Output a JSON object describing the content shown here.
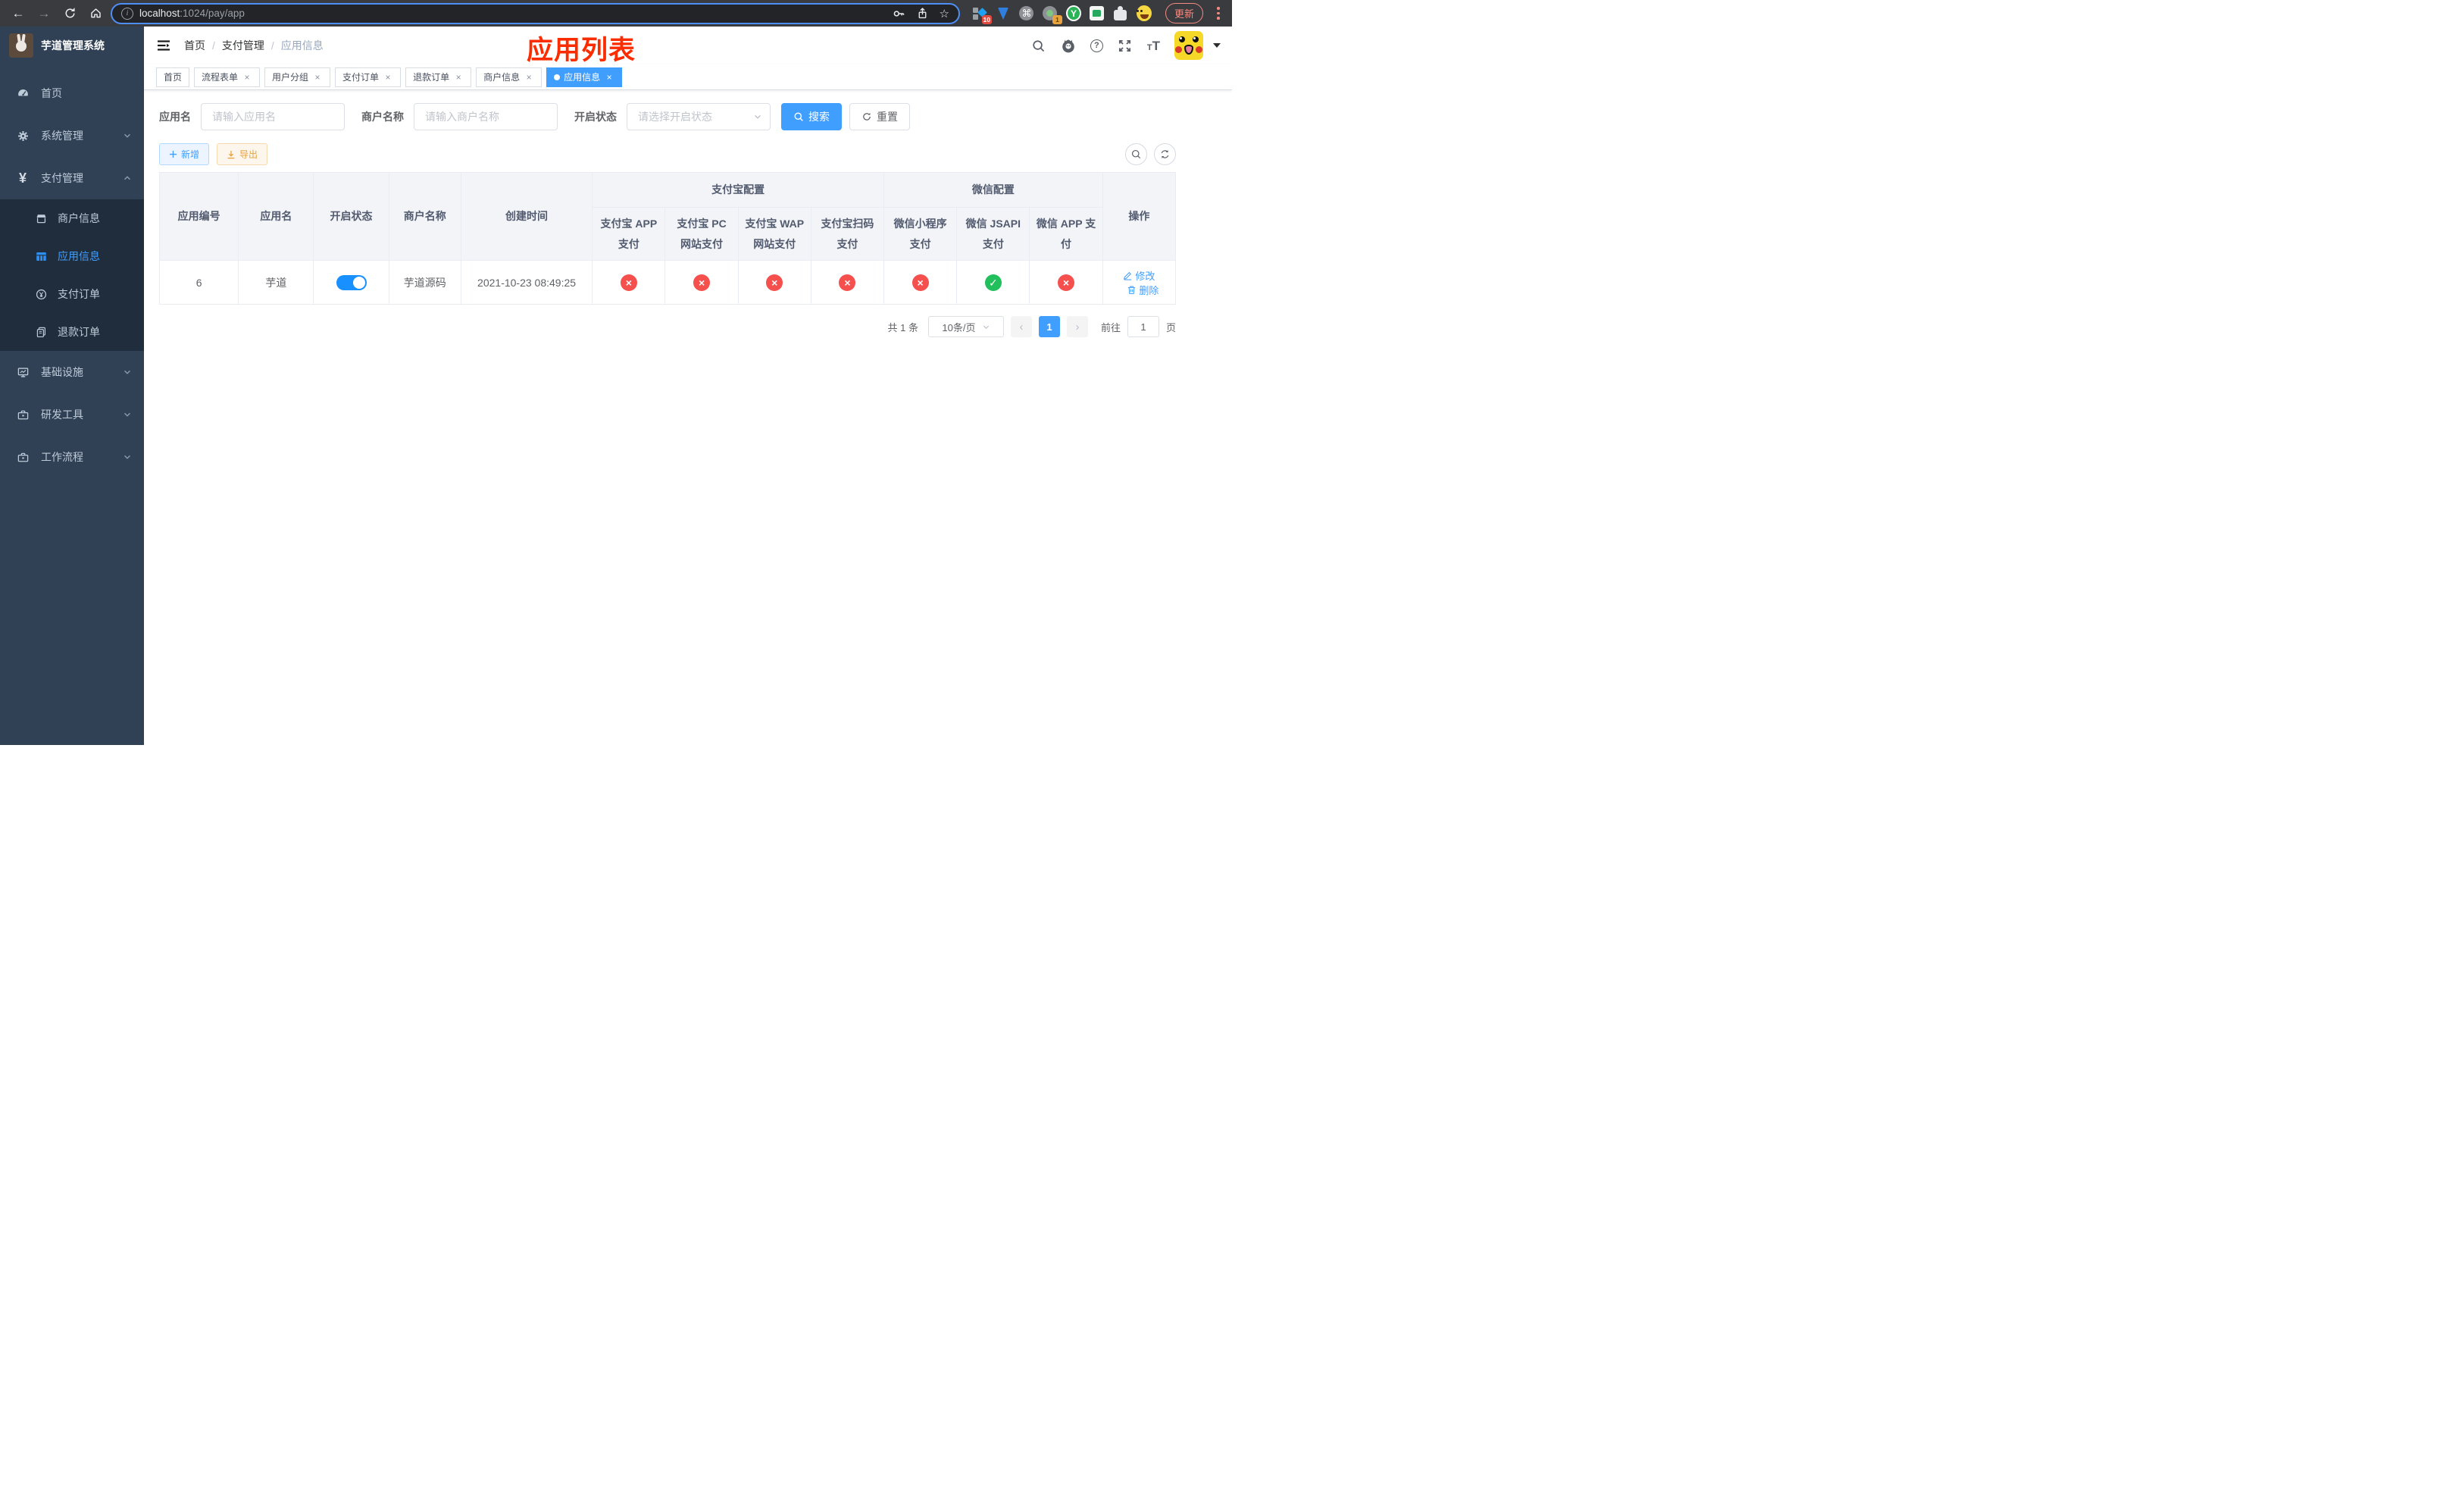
{
  "colors": {
    "primary": "#409EFF",
    "toggle_on": "#1890ff",
    "danger": "#f5504d",
    "success": "#22c05c",
    "annotation": "#fb2c00",
    "sidebar_bg": "#304156",
    "submenu_bg": "#1f2d3d"
  },
  "icons": {
    "close_glyph": "×",
    "check_glyph": "✓",
    "cross_glyph": "×",
    "back_glyph": "←",
    "forward_glyph": "→",
    "star_glyph": "☆",
    "cmd_glyph": "⌘",
    "prev_glyph": "‹",
    "next_glyph": "›",
    "help_glyph": "?",
    "info_glyph": "i",
    "yen_glyph": "¥",
    "ext_y_glyph": "Y",
    "size_small": "T",
    "size_large": "T"
  },
  "browser": {
    "url_host": "localhost",
    "url_path": ":1024/pay/app",
    "ext_badge_blue_diamond": "10",
    "ext_badge_recorder": "1",
    "update_label": "更新"
  },
  "sidebar": {
    "title": "芋道管理系统",
    "items": [
      {
        "label": "首页",
        "icon": "dashboard-icon"
      },
      {
        "label": "系统管理",
        "icon": "gear-icon",
        "chevron": "down"
      },
      {
        "label": "支付管理",
        "icon": "yen-icon",
        "chevron": "up",
        "expanded": true
      },
      {
        "label": "商户信息",
        "icon": "shop-icon",
        "sub": true
      },
      {
        "label": "应用信息",
        "icon": "grid-icon",
        "sub": true,
        "active": true
      },
      {
        "label": "支付订单",
        "icon": "coin-icon",
        "sub": true
      },
      {
        "label": "退款订单",
        "icon": "documents-icon",
        "sub": true
      },
      {
        "label": "基础设施",
        "icon": "monitor-icon",
        "chevron": "down"
      },
      {
        "label": "研发工具",
        "icon": "toolbox-icon",
        "chevron": "down"
      },
      {
        "label": "工作流程",
        "icon": "toolbox-icon",
        "chevron": "down"
      }
    ]
  },
  "navbar": {
    "breadcrumb": [
      "首页",
      "支付管理",
      "应用信息"
    ],
    "separator": "/",
    "annotation": "应用列表"
  },
  "tabs": [
    {
      "label": "首页",
      "closable": false,
      "active": false
    },
    {
      "label": "流程表单",
      "closable": true,
      "active": false
    },
    {
      "label": "用户分组",
      "closable": true,
      "active": false
    },
    {
      "label": "支付订单",
      "closable": true,
      "active": false
    },
    {
      "label": "退款订单",
      "closable": true,
      "active": false
    },
    {
      "label": "商户信息",
      "closable": true,
      "active": false
    },
    {
      "label": "应用信息",
      "closable": true,
      "active": true
    }
  ],
  "filters": {
    "app_name_label": "应用名",
    "app_name_placeholder": "请输入应用名",
    "merchant_label": "商户名称",
    "merchant_placeholder": "请输入商户名称",
    "status_label": "开启状态",
    "status_placeholder": "请选择开启状态",
    "search_label": "搜索",
    "reset_label": "重置"
  },
  "toolbar": {
    "add_label": "新增",
    "export_label": "导出"
  },
  "table": {
    "group_headers": {
      "alipay": "支付宝配置",
      "wechat": "微信配置"
    },
    "headers": {
      "app_id": "应用编号",
      "app_name": "应用名",
      "status": "开启状态",
      "merchant": "商户名称",
      "created": "创建时间",
      "alipay_app": "支付宝 APP 支付",
      "alipay_pc": "支付宝 PC 网站支付",
      "alipay_wap": "支付宝 WAP 网站支付",
      "alipay_qr": "支付宝扫码支付",
      "wx_mini": "微信小程序支付",
      "wx_jsapi": "微信 JSAPI 支付",
      "wx_app": "微信 APP 支付",
      "op": "操作"
    },
    "row": {
      "app_id": "6",
      "app_name": "芋道",
      "status_on": true,
      "merchant": "芋道源码",
      "created": "2021-10-23 08:49:25",
      "channels": [
        "no",
        "no",
        "no",
        "no",
        "no",
        "yes",
        "no"
      ],
      "edit_label": "修改",
      "delete_label": "删除"
    }
  },
  "pagination": {
    "total_text": "共 1 条",
    "page_size": "10条/页",
    "current_page": "1",
    "goto_label": "前往",
    "goto_value": "1",
    "page_unit": "页"
  }
}
